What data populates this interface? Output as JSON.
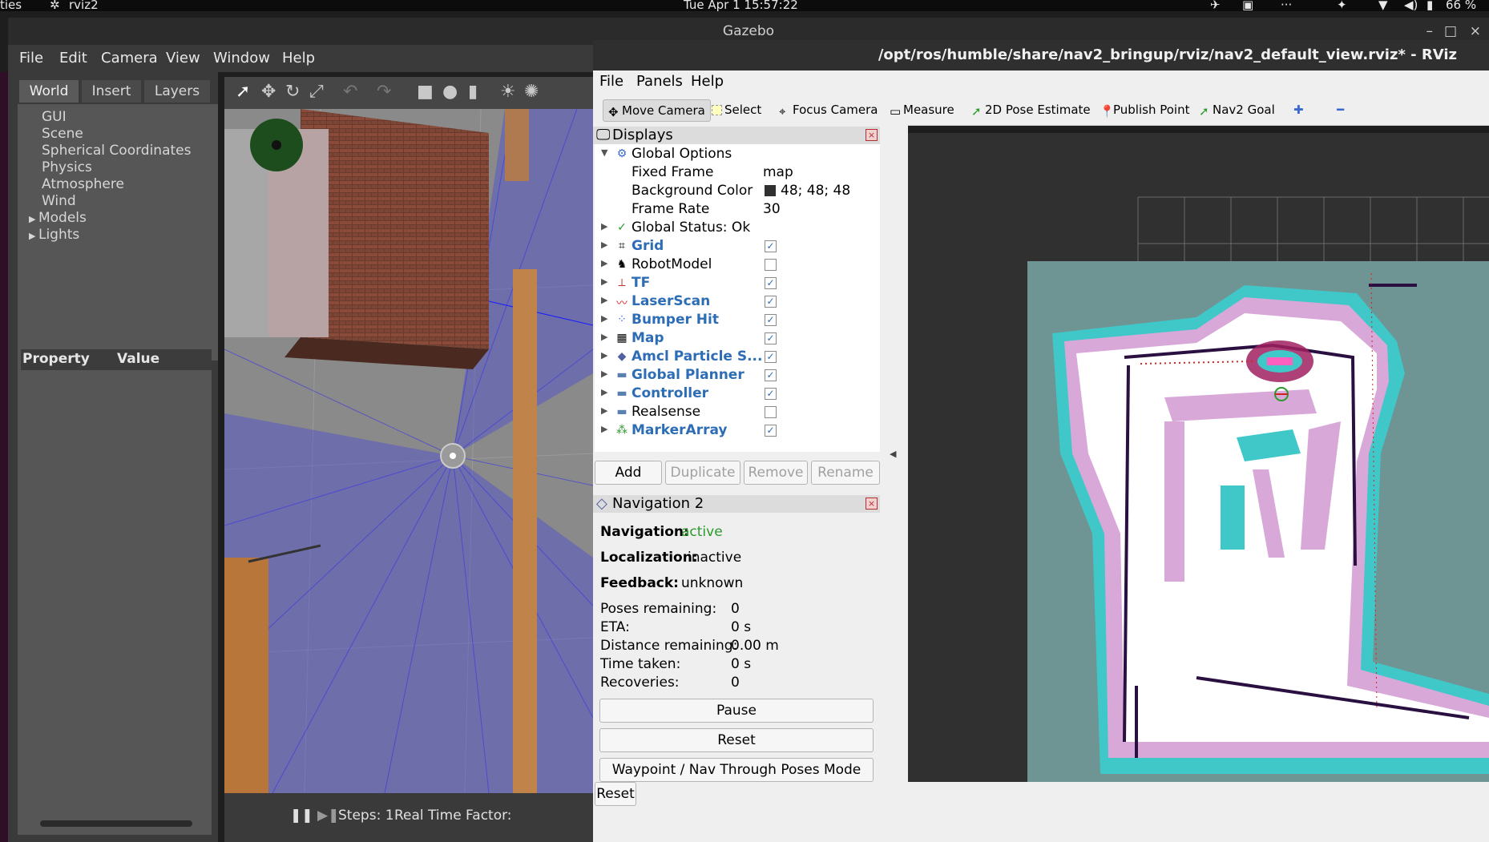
{
  "system_bar": {
    "left_text": "ties",
    "app_name": "rviz2",
    "datetime": "Tue Apr 1  15:57:22",
    "battery": "66 %"
  },
  "gazebo": {
    "title": "Gazebo",
    "menu": [
      "File",
      "Edit",
      "Camera",
      "View",
      "Window",
      "Help"
    ],
    "tabs": [
      "World",
      "Insert",
      "Layers"
    ],
    "world_tree": [
      "GUI",
      "Scene",
      "Spherical Coordinates",
      "Physics",
      "Atmosphere",
      "Wind",
      "Models",
      "Lights"
    ],
    "property_header": {
      "property": "Property",
      "value": "Value"
    },
    "bottom": {
      "steps_label": "Steps: 1",
      "rtf_label": "Real Time Factor:"
    }
  },
  "rviz": {
    "title": "/opt/ros/humble/share/nav2_bringup/rviz/nav2_default_view.rviz* - RViz",
    "menu": [
      "File",
      "Panels",
      "Help"
    ],
    "toolbar": [
      "Move Camera",
      "Select",
      "Focus Camera",
      "Measure",
      "2D Pose Estimate",
      "Publish Point",
      "Nav2 Goal"
    ],
    "displays": {
      "title": "Displays",
      "global_options": "Global Options",
      "fixed_frame": {
        "label": "Fixed Frame",
        "value": "map"
      },
      "background_color": {
        "label": "Background Color",
        "value": "48; 48; 48",
        "swatch": "#303030"
      },
      "frame_rate": {
        "label": "Frame Rate",
        "value": "30"
      },
      "global_status": "Global Status: Ok",
      "items": [
        {
          "name": "Grid",
          "checked": true
        },
        {
          "name": "RobotModel",
          "checked": false
        },
        {
          "name": "TF",
          "checked": true
        },
        {
          "name": "LaserScan",
          "checked": true
        },
        {
          "name": "Bumper Hit",
          "checked": true
        },
        {
          "name": "Map",
          "checked": true
        },
        {
          "name": "Amcl Particle S...",
          "checked": true
        },
        {
          "name": "Global Planner",
          "checked": true
        },
        {
          "name": "Controller",
          "checked": true
        },
        {
          "name": "Realsense",
          "checked": false
        },
        {
          "name": "MarkerArray",
          "checked": true
        }
      ],
      "buttons": [
        "Add",
        "Duplicate",
        "Remove",
        "Rename"
      ]
    },
    "navigation": {
      "title": "Navigation 2",
      "navigation_label": "Navigation:",
      "navigation_value": "active",
      "localization_label": "Localization:",
      "localization_value": "inactive",
      "feedback_label": "Feedback:",
      "feedback_value": "unknown",
      "stats": [
        {
          "label": "Poses remaining:",
          "value": "0"
        },
        {
          "label": "ETA:",
          "value": "0 s"
        },
        {
          "label": "Distance remaining:",
          "value": "0.00 m"
        },
        {
          "label": "Time taken:",
          "value": "0 s"
        },
        {
          "label": "Recoveries:",
          "value": "0"
        }
      ],
      "buttons": [
        "Pause",
        "Reset",
        "Waypoint / Nav Through Poses Mode"
      ]
    },
    "reset_button": "Reset"
  }
}
